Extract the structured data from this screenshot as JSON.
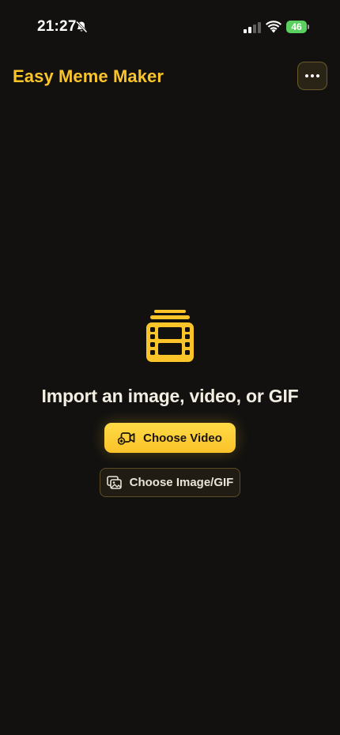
{
  "status_bar": {
    "time": "21:27",
    "battery_level": "46",
    "icons": [
      "bell-slash-icon",
      "cellular-signal-icon",
      "wifi-icon",
      "battery-charging-icon"
    ]
  },
  "header": {
    "title": "Easy Meme Maker",
    "more_icon": "ellipsis-icon"
  },
  "main": {
    "hero_icon": "film-stack-icon",
    "prompt": "Import an image, video, or GIF",
    "primary_button": {
      "label": "Choose Video",
      "icon": "video-camera-add-icon"
    },
    "secondary_button": {
      "label": "Choose Image/GIF",
      "icon": "photo-stack-icon"
    }
  },
  "colors": {
    "accent": "#fbc52a",
    "background": "#121110",
    "battery_green": "#5ad05f"
  }
}
